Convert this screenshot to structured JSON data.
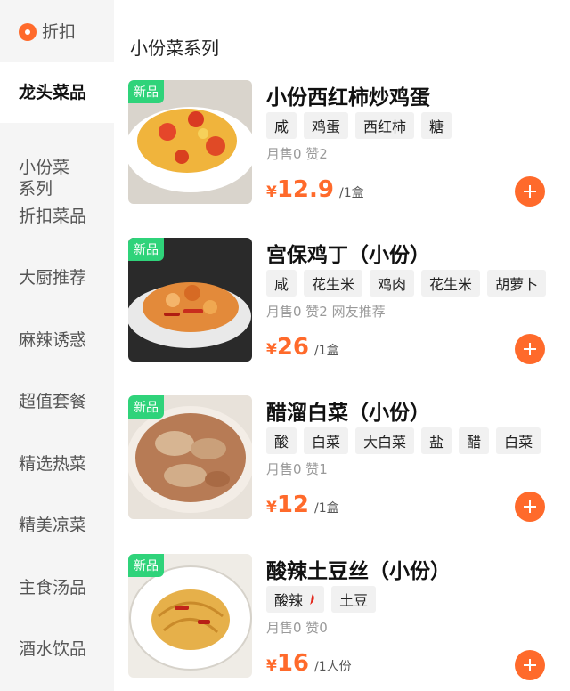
{
  "sidebar": {
    "discount_label": "折扣",
    "items": [
      "龙头菜品",
      "小份菜\n系列",
      "折扣菜品",
      "大厨推荐",
      "麻辣诱惑",
      "超值套餐",
      "精选热菜",
      "精美凉菜",
      "主食汤品",
      "酒水饮品"
    ],
    "active_index": 0
  },
  "section": {
    "title": "小份菜系列"
  },
  "badge_new": "新品",
  "colors": {
    "accent": "#ff6a2b",
    "badge": "#2fd37a",
    "sidebar_bg": "#f5f5f5"
  },
  "dishes": [
    {
      "name": "小份西红柿炒鸡蛋",
      "tags": [
        "咸",
        "鸡蛋",
        "西红柿",
        "糖"
      ],
      "stats": "月售0 赞2",
      "price_currency": "¥",
      "price": "12.9",
      "unit": "/1盒"
    },
    {
      "name": "宫保鸡丁（小份）",
      "tags": [
        "咸",
        "花生米",
        "鸡肉",
        "花生米",
        "胡萝卜"
      ],
      "stats": "月售0 赞2 网友推荐",
      "price_currency": "¥",
      "price": "26",
      "unit": "/1盒"
    },
    {
      "name": "醋溜白菜（小份）",
      "tags": [
        "酸",
        "白菜",
        "大白菜",
        "盐",
        "醋",
        "白菜"
      ],
      "stats": "月售0 赞1",
      "price_currency": "¥",
      "price": "12",
      "unit": "/1盒"
    },
    {
      "name": "酸辣土豆丝（小份）",
      "tags": [
        "酸辣",
        "土豆"
      ],
      "stats": "月售0 赞0",
      "price_currency": "¥",
      "price": "16",
      "unit": "/1人份"
    }
  ]
}
